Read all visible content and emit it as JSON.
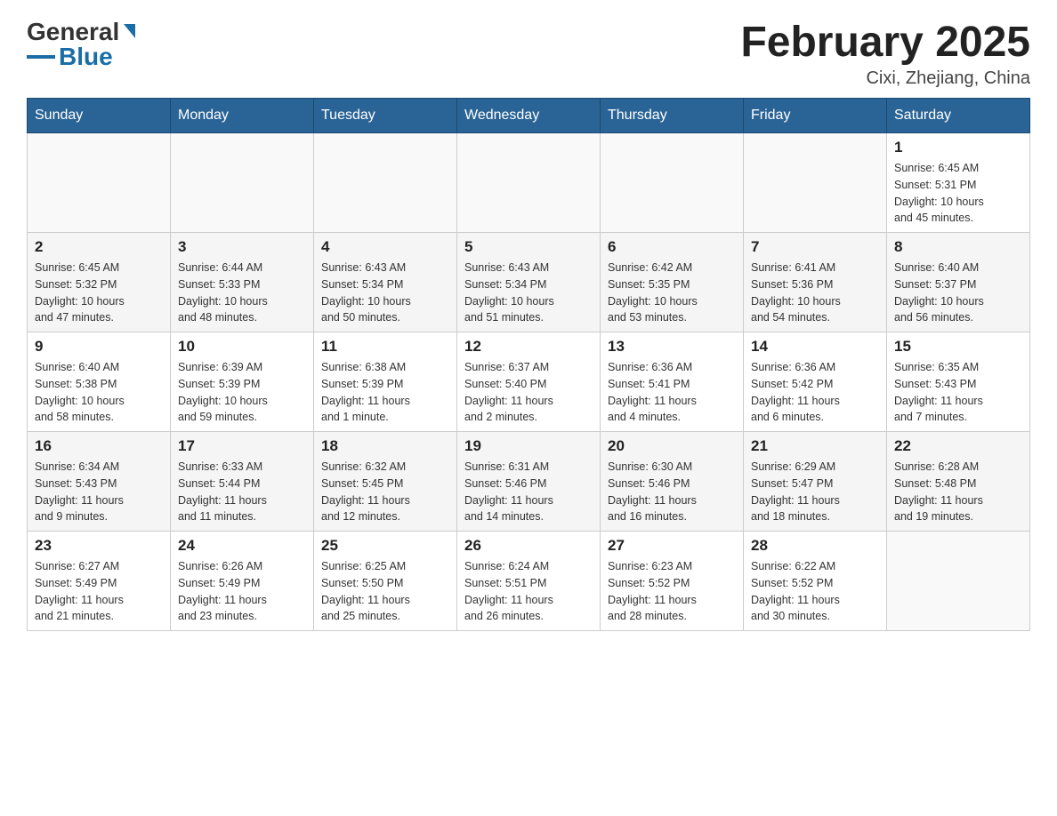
{
  "header": {
    "logo_general": "General",
    "logo_blue": "Blue",
    "title": "February 2025",
    "location": "Cixi, Zhejiang, China"
  },
  "weekdays": [
    "Sunday",
    "Monday",
    "Tuesday",
    "Wednesday",
    "Thursday",
    "Friday",
    "Saturday"
  ],
  "weeks": [
    [
      {
        "day": "",
        "info": ""
      },
      {
        "day": "",
        "info": ""
      },
      {
        "day": "",
        "info": ""
      },
      {
        "day": "",
        "info": ""
      },
      {
        "day": "",
        "info": ""
      },
      {
        "day": "",
        "info": ""
      },
      {
        "day": "1",
        "info": "Sunrise: 6:45 AM\nSunset: 5:31 PM\nDaylight: 10 hours\nand 45 minutes."
      }
    ],
    [
      {
        "day": "2",
        "info": "Sunrise: 6:45 AM\nSunset: 5:32 PM\nDaylight: 10 hours\nand 47 minutes."
      },
      {
        "day": "3",
        "info": "Sunrise: 6:44 AM\nSunset: 5:33 PM\nDaylight: 10 hours\nand 48 minutes."
      },
      {
        "day": "4",
        "info": "Sunrise: 6:43 AM\nSunset: 5:34 PM\nDaylight: 10 hours\nand 50 minutes."
      },
      {
        "day": "5",
        "info": "Sunrise: 6:43 AM\nSunset: 5:34 PM\nDaylight: 10 hours\nand 51 minutes."
      },
      {
        "day": "6",
        "info": "Sunrise: 6:42 AM\nSunset: 5:35 PM\nDaylight: 10 hours\nand 53 minutes."
      },
      {
        "day": "7",
        "info": "Sunrise: 6:41 AM\nSunset: 5:36 PM\nDaylight: 10 hours\nand 54 minutes."
      },
      {
        "day": "8",
        "info": "Sunrise: 6:40 AM\nSunset: 5:37 PM\nDaylight: 10 hours\nand 56 minutes."
      }
    ],
    [
      {
        "day": "9",
        "info": "Sunrise: 6:40 AM\nSunset: 5:38 PM\nDaylight: 10 hours\nand 58 minutes."
      },
      {
        "day": "10",
        "info": "Sunrise: 6:39 AM\nSunset: 5:39 PM\nDaylight: 10 hours\nand 59 minutes."
      },
      {
        "day": "11",
        "info": "Sunrise: 6:38 AM\nSunset: 5:39 PM\nDaylight: 11 hours\nand 1 minute."
      },
      {
        "day": "12",
        "info": "Sunrise: 6:37 AM\nSunset: 5:40 PM\nDaylight: 11 hours\nand 2 minutes."
      },
      {
        "day": "13",
        "info": "Sunrise: 6:36 AM\nSunset: 5:41 PM\nDaylight: 11 hours\nand 4 minutes."
      },
      {
        "day": "14",
        "info": "Sunrise: 6:36 AM\nSunset: 5:42 PM\nDaylight: 11 hours\nand 6 minutes."
      },
      {
        "day": "15",
        "info": "Sunrise: 6:35 AM\nSunset: 5:43 PM\nDaylight: 11 hours\nand 7 minutes."
      }
    ],
    [
      {
        "day": "16",
        "info": "Sunrise: 6:34 AM\nSunset: 5:43 PM\nDaylight: 11 hours\nand 9 minutes."
      },
      {
        "day": "17",
        "info": "Sunrise: 6:33 AM\nSunset: 5:44 PM\nDaylight: 11 hours\nand 11 minutes."
      },
      {
        "day": "18",
        "info": "Sunrise: 6:32 AM\nSunset: 5:45 PM\nDaylight: 11 hours\nand 12 minutes."
      },
      {
        "day": "19",
        "info": "Sunrise: 6:31 AM\nSunset: 5:46 PM\nDaylight: 11 hours\nand 14 minutes."
      },
      {
        "day": "20",
        "info": "Sunrise: 6:30 AM\nSunset: 5:46 PM\nDaylight: 11 hours\nand 16 minutes."
      },
      {
        "day": "21",
        "info": "Sunrise: 6:29 AM\nSunset: 5:47 PM\nDaylight: 11 hours\nand 18 minutes."
      },
      {
        "day": "22",
        "info": "Sunrise: 6:28 AM\nSunset: 5:48 PM\nDaylight: 11 hours\nand 19 minutes."
      }
    ],
    [
      {
        "day": "23",
        "info": "Sunrise: 6:27 AM\nSunset: 5:49 PM\nDaylight: 11 hours\nand 21 minutes."
      },
      {
        "day": "24",
        "info": "Sunrise: 6:26 AM\nSunset: 5:49 PM\nDaylight: 11 hours\nand 23 minutes."
      },
      {
        "day": "25",
        "info": "Sunrise: 6:25 AM\nSunset: 5:50 PM\nDaylight: 11 hours\nand 25 minutes."
      },
      {
        "day": "26",
        "info": "Sunrise: 6:24 AM\nSunset: 5:51 PM\nDaylight: 11 hours\nand 26 minutes."
      },
      {
        "day": "27",
        "info": "Sunrise: 6:23 AM\nSunset: 5:52 PM\nDaylight: 11 hours\nand 28 minutes."
      },
      {
        "day": "28",
        "info": "Sunrise: 6:22 AM\nSunset: 5:52 PM\nDaylight: 11 hours\nand 30 minutes."
      },
      {
        "day": "",
        "info": ""
      }
    ]
  ]
}
